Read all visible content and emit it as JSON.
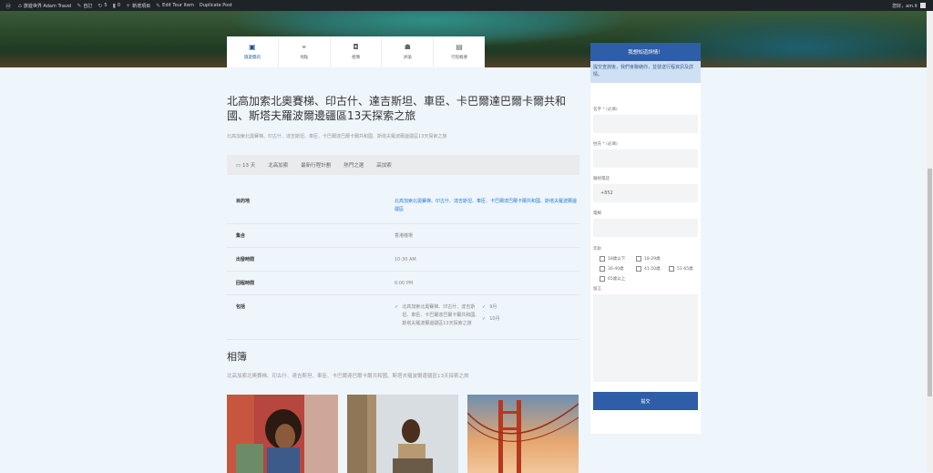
{
  "admin_bar": {
    "site": "旅遊世界 Adam Travel",
    "customize": "自訂",
    "updates_count": "5",
    "comments_count": "0",
    "new": "新增項目",
    "edit": "Edit Tour Item",
    "duplicate": "Duplicate Post",
    "howdy": "您好，am.it"
  },
  "tabs": [
    {
      "label": "旅遊資訊",
      "icon": "info-icon"
    },
    {
      "label": "地點",
      "icon": "map-pin-icon"
    },
    {
      "label": "相簿",
      "icon": "camera-icon"
    },
    {
      "label": "評論",
      "icon": "users-icon"
    },
    {
      "label": "行程概要",
      "icon": "calendar-icon"
    }
  ],
  "tour": {
    "title": "北高加索北奧賽梯、印古什、達吉斯坦、車臣、卡巴爾達巴爾卡爾共和國、斯塔夫羅波爾邊疆區13天探索之旅",
    "subtitle": "北高加索北奧賽梯、印古什、達吉斯坦、車臣、卡巴爾達巴爾卡爾共和國、斯塔夫羅波爾邊疆區13天探索之旅",
    "meta": [
      "13 天",
      "北高加索",
      "最新行程計劃",
      "熱門之選",
      "高加索"
    ]
  },
  "details": {
    "destination_label": "目的地",
    "destination_value": "北高加索北奧賽梯、印古什、達吉斯坦、車臣、卡巴爾達巴爾卡爾共和國、斯塔夫羅波爾邊疆區",
    "meeting_label": "集合",
    "meeting_value": "香港機場",
    "depart_label": "出發時間",
    "depart_value": "10:30 AM",
    "return_label": "回程時間",
    "return_value": "6:00 PM",
    "included_label": "包括",
    "included_items": [
      "北高加索北奧賽梯、印古什、達吉斯坦、車臣、卡巴爾達巴爾卡爾共和國、斯塔夫羅波爾邊疆區13天探索之旅"
    ],
    "included_months": [
      "9月",
      "10月"
    ]
  },
  "gallery": {
    "title": "相簿",
    "subtitle": "北高加索北奧賽梯、印古什、達吉斯坦、車臣、卡巴爾達巴爾卡爾共和國、斯塔夫羅波爾邊疆區13天探索之旅"
  },
  "form": {
    "heading": "我想知道詳情！",
    "intro": "提交查詢後，我們會聯絡你，並發送行程資訊及詳情。",
    "first_name_label": "名字 * (必填)",
    "last_name_label": "姓氏 * (必填)",
    "phone_label": "聯絡電話",
    "phone_value": "+852",
    "email_label": "電郵",
    "age_label": "年齡",
    "age_options": [
      "18歲以下",
      "18-29歲",
      "30-40歲",
      "41-50歲",
      "51-65歲",
      "65歲以上"
    ],
    "message_label": "留言",
    "submit_label": "提交"
  },
  "colors": {
    "brand_blue": "#2e5ea8",
    "admin_bar": "#1d2327",
    "page_bg": "#eef5fb"
  }
}
